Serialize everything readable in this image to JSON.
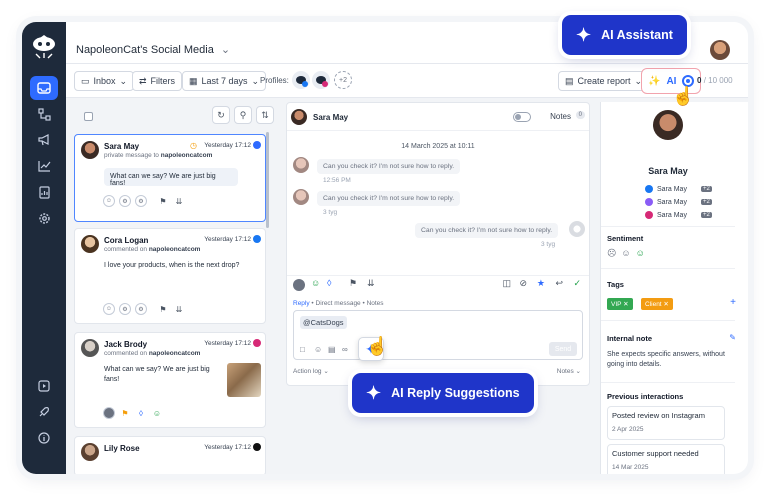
{
  "app": {
    "workspace_name": "NapoleonCat's Social Media",
    "chevron": "chevron-down-icon"
  },
  "nav": {
    "icons": [
      "inbox-icon",
      "hierarchy-icon",
      "megaphone-icon",
      "chart-icon",
      "report-icon",
      "settings-icon"
    ],
    "bottom_icons": [
      "play-icon",
      "rocket-icon",
      "info-icon"
    ]
  },
  "toolbar": {
    "inbox_label": "Inbox",
    "filters_label": "Filters",
    "date_label": "Last 7 days",
    "profiles_label": "Profiles:",
    "more_profiles": "+2",
    "create_report_label": "Create report",
    "ai_label": "AI",
    "quota_used": "0",
    "quota_total": "/ 10 000"
  },
  "list": {
    "items": [
      {
        "name": "Sara May",
        "subtitle_prefix": "private message to",
        "subtitle_account": "napoleoncatcom",
        "time": "Yesterday 17:12",
        "network": "messenger",
        "text": "What can we say? We are just big fans!"
      },
      {
        "name": "Cora Logan",
        "subtitle_prefix": "commented on",
        "subtitle_account": "napoleoncatcom",
        "time": "Yesterday 17:12",
        "network": "facebook",
        "text": "I love your products, when is the next drop?"
      },
      {
        "name": "Jack Brody",
        "subtitle_prefix": "commented on",
        "subtitle_account": "napoleoncatcom",
        "time": "Yesterday 17:12",
        "network": "instagram",
        "text": "What can we say? We are just big fans!"
      },
      {
        "name": "Lily Rose",
        "time": "Yesterday 17:12",
        "network": "tiktok"
      }
    ]
  },
  "conversation": {
    "contact_name": "Sara May",
    "notes_label": "Notes",
    "notes_count": "0",
    "date": "14 March 2025 at 10:11",
    "messages": [
      {
        "text": "Can you check it? I'm not sure how to reply.",
        "time": "12:56 PM",
        "direction": "in"
      },
      {
        "text": "Can you check it? I'm not sure how to reply.",
        "time": "3 tyg",
        "direction": "in"
      },
      {
        "text": "Can you check it? I'm not sure how to reply.",
        "time": "3 tyg",
        "direction": "out"
      }
    ],
    "reply_tabs": [
      "Reply",
      "Direct message",
      "Notes"
    ],
    "composer_text": "@CatsDogs",
    "send_label": "Send",
    "action_log_label": "Action log",
    "notes_dropdown_label": "Notes"
  },
  "sidebar": {
    "contact_name": "Sara May",
    "profiles": [
      {
        "name": "Sara May",
        "network": "facebook",
        "badge": "+2",
        "color": "#1877f2"
      },
      {
        "name": "Sara May",
        "network": "messenger",
        "badge": "+2",
        "color": "#8a5cf6"
      },
      {
        "name": "Sara May",
        "network": "instagram",
        "badge": "+2",
        "color": "#d62976"
      }
    ],
    "sentiment_title": "Sentiment",
    "tags_title": "Tags",
    "tags": [
      {
        "label": "VIP",
        "color": "#33a852"
      },
      {
        "label": "Client",
        "color": "#f39c12"
      }
    ],
    "internal_note_title": "Internal note",
    "internal_note_text": "She expects specific answers, without going into details.",
    "previous_title": "Previous interactions",
    "previous": [
      {
        "title": "Posted review on Instagram",
        "date": "2 Apr 2025"
      },
      {
        "title": "Customer support needed",
        "date": "14 Mar 2025"
      }
    ]
  },
  "callouts": {
    "ai_assistant": "AI Assistant",
    "ai_reply_suggestions": "AI Reply Suggestions"
  },
  "colors": {
    "accent": "#2e6bff",
    "pill": "#1f35c9",
    "nav_bg": "#1e2a3b"
  }
}
